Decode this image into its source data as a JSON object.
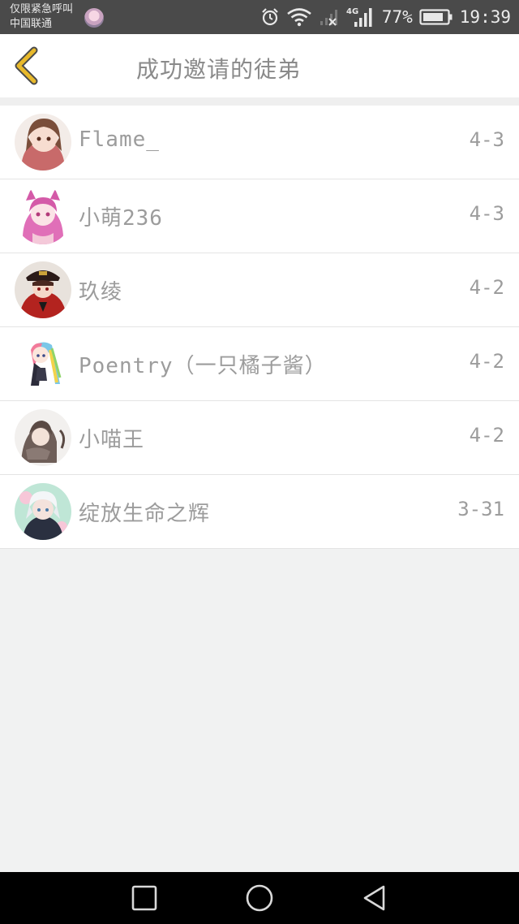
{
  "status_bar": {
    "carrier_line1": "仅限紧急呼叫",
    "carrier_line2": "中国联通",
    "network": "4G",
    "battery_pct": "77%",
    "time": "19:39"
  },
  "header": {
    "title": "成功邀请的徒弟"
  },
  "invitees": [
    {
      "name": "Flame_",
      "date": "4-3",
      "avatar_icon": "avatar-brown-hair"
    },
    {
      "name": "小萌236",
      "date": "4-3",
      "avatar_icon": "avatar-pink-hair"
    },
    {
      "name": "玖绫",
      "date": "4-2",
      "avatar_icon": "avatar-red-uniform"
    },
    {
      "name": "Poentry（一只橘子酱）",
      "date": "4-2",
      "avatar_icon": "avatar-rainbow-hair"
    },
    {
      "name": "小喵王",
      "date": "4-2",
      "avatar_icon": "avatar-gray-hair"
    },
    {
      "name": "绽放生命之辉",
      "date": "3-31",
      "avatar_icon": "avatar-white-hair"
    }
  ],
  "nav_bar": {
    "recents_icon": "square-icon",
    "home_icon": "circle-icon",
    "back_icon": "triangle-back-icon"
  },
  "colors": {
    "accent": "#e8b92b",
    "status_bar": "#4a4a4a",
    "background": "#f1f2f2"
  }
}
